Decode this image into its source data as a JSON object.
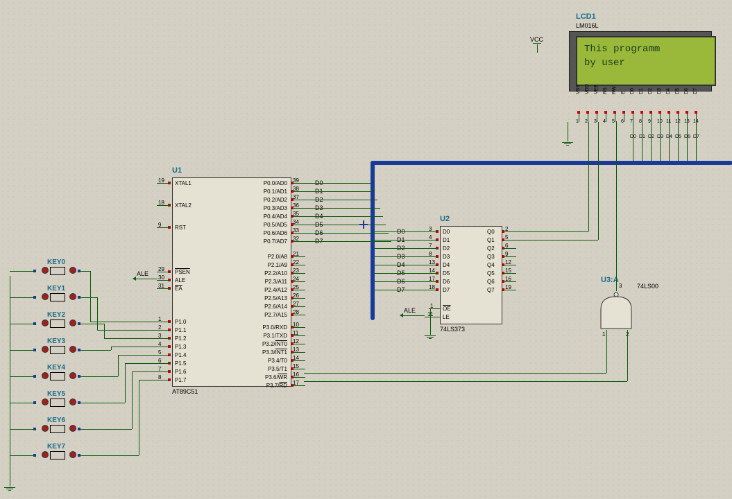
{
  "lcd": {
    "ref": "LCD1",
    "part": "LM016L",
    "line1": "This programm",
    "line2": " by user",
    "pins": [
      "VSS",
      "VDD",
      "VEE",
      "RS",
      "RW",
      "E",
      "D0",
      "D1",
      "D2",
      "D3",
      "D4",
      "D5",
      "D6",
      "D7"
    ],
    "pin_nums": [
      "1",
      "2",
      "3",
      "4",
      "5",
      "6",
      "7",
      "8",
      "9",
      "10",
      "11",
      "12",
      "13",
      "14"
    ]
  },
  "u1": {
    "ref": "U1",
    "part": "AT89C51",
    "left_pins": [
      {
        "num": "19",
        "name": "XTAL1"
      },
      {
        "num": "18",
        "name": "XTAL2"
      },
      {
        "num": "9",
        "name": "RST"
      },
      {
        "num": "29",
        "name": "PSEN"
      },
      {
        "num": "30",
        "name": "ALE"
      },
      {
        "num": "31",
        "name": "EA"
      },
      {
        "num": "1",
        "name": "P1.0"
      },
      {
        "num": "2",
        "name": "P1.1"
      },
      {
        "num": "3",
        "name": "P1.2"
      },
      {
        "num": "4",
        "name": "P1.3"
      },
      {
        "num": "5",
        "name": "P1.4"
      },
      {
        "num": "6",
        "name": "P1.5"
      },
      {
        "num": "7",
        "name": "P1.6"
      },
      {
        "num": "8",
        "name": "P1.7"
      }
    ],
    "right_pins_top": [
      {
        "num": "39",
        "name": "P0.0/AD0",
        "bus": "D0"
      },
      {
        "num": "38",
        "name": "P0.1/AD1",
        "bus": "D1"
      },
      {
        "num": "37",
        "name": "P0.2/AD2",
        "bus": "D2"
      },
      {
        "num": "36",
        "name": "P0.3/AD3",
        "bus": "D3"
      },
      {
        "num": "35",
        "name": "P0.4/AD4",
        "bus": "D4"
      },
      {
        "num": "34",
        "name": "P0.5/AD5",
        "bus": "D5"
      },
      {
        "num": "33",
        "name": "P0.6/AD6",
        "bus": "D6"
      },
      {
        "num": "32",
        "name": "P0.7/AD7",
        "bus": "D7"
      }
    ],
    "right_pins_mid": [
      {
        "num": "21",
        "name": "P2.0/A8"
      },
      {
        "num": "22",
        "name": "P2.1/A9"
      },
      {
        "num": "23",
        "name": "P2.2/A10"
      },
      {
        "num": "24",
        "name": "P2.3/A11"
      },
      {
        "num": "25",
        "name": "P2.4/A12"
      },
      {
        "num": "26",
        "name": "P2.5/A13"
      },
      {
        "num": "27",
        "name": "P2.6/A14"
      },
      {
        "num": "28",
        "name": "P2.7/A15"
      }
    ],
    "right_pins_bot": [
      {
        "num": "10",
        "name": "P3.0/RXD"
      },
      {
        "num": "11",
        "name": "P3.1/TXD"
      },
      {
        "num": "12",
        "name": "P3.2/INT0"
      },
      {
        "num": "13",
        "name": "P3.3/INT1"
      },
      {
        "num": "14",
        "name": "P3.4/T0"
      },
      {
        "num": "15",
        "name": "P3.5/T1"
      },
      {
        "num": "16",
        "name": "P3.6/WR"
      },
      {
        "num": "17",
        "name": "P3.7/RD"
      }
    ]
  },
  "u2": {
    "ref": "U2",
    "part": "74LS373",
    "left_pins": [
      {
        "num": "3",
        "name": "D0",
        "bus": "D0"
      },
      {
        "num": "4",
        "name": "D1",
        "bus": "D1"
      },
      {
        "num": "7",
        "name": "D2",
        "bus": "D2"
      },
      {
        "num": "8",
        "name": "D3",
        "bus": "D3"
      },
      {
        "num": "13",
        "name": "D4",
        "bus": "D4"
      },
      {
        "num": "14",
        "name": "D5",
        "bus": "D5"
      },
      {
        "num": "17",
        "name": "D6",
        "bus": "D6"
      },
      {
        "num": "18",
        "name": "D7",
        "bus": "D7"
      }
    ],
    "right_pins": [
      {
        "num": "2",
        "name": "Q0"
      },
      {
        "num": "5",
        "name": "Q1"
      },
      {
        "num": "6",
        "name": "Q2"
      },
      {
        "num": "9",
        "name": "Q3"
      },
      {
        "num": "12",
        "name": "Q4"
      },
      {
        "num": "15",
        "name": "Q5"
      },
      {
        "num": "16",
        "name": "Q6"
      },
      {
        "num": "19",
        "name": "Q7"
      }
    ],
    "oe": {
      "num": "1",
      "name": "OE"
    },
    "le": {
      "num": "11",
      "name": "LE"
    }
  },
  "u3": {
    "ref": "U3:A",
    "part": "74LS00",
    "pins": {
      "a": "1",
      "b": "2",
      "y": "3"
    }
  },
  "keys": [
    "KEY0",
    "KEY1",
    "KEY2",
    "KEY3",
    "KEY4",
    "KEY5",
    "KEY6",
    "KEY7"
  ],
  "nets": {
    "ale": "ALE",
    "vcc": "VCC"
  },
  "lcd_bus_labels": [
    "D0",
    "D1",
    "D2",
    "D3",
    "D4",
    "D5",
    "D6",
    "D7"
  ]
}
